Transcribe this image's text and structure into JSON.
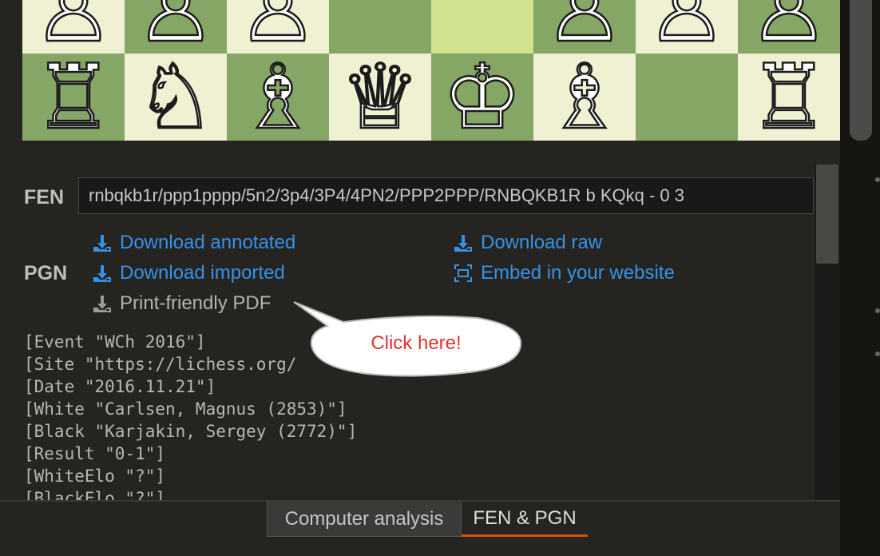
{
  "board": {
    "rows": [
      [
        {
          "piece": "♙",
          "name": "white-pawn-a2-icon",
          "shade": "light"
        },
        {
          "piece": "♙",
          "name": "white-pawn-b2-icon",
          "shade": "dark"
        },
        {
          "piece": "♙",
          "name": "white-pawn-c2-icon",
          "shade": "light"
        },
        {
          "piece": "",
          "name": "square-d2",
          "shade": "dark"
        },
        {
          "piece": "",
          "name": "square-e2",
          "shade": "hl-light"
        },
        {
          "piece": "♙",
          "name": "white-pawn-f2-icon",
          "shade": "dark"
        },
        {
          "piece": "♙",
          "name": "white-pawn-g2-icon",
          "shade": "light"
        },
        {
          "piece": "♙",
          "name": "white-pawn-h2-icon",
          "shade": "dark"
        }
      ],
      [
        {
          "piece": "♖",
          "name": "white-rook-a1-icon",
          "shade": "dark"
        },
        {
          "piece": "♘",
          "name": "white-knight-b1-icon",
          "shade": "light"
        },
        {
          "piece": "♗",
          "name": "white-bishop-c1-icon",
          "shade": "dark"
        },
        {
          "piece": "♕",
          "name": "white-queen-d1-icon",
          "shade": "light"
        },
        {
          "piece": "♔",
          "name": "white-king-e1-icon",
          "shade": "dark"
        },
        {
          "piece": "♗",
          "name": "white-bishop-f1-icon",
          "shade": "light"
        },
        {
          "piece": "",
          "name": "square-g1",
          "shade": "dark"
        },
        {
          "piece": "♖",
          "name": "white-rook-h1-icon",
          "shade": "light"
        }
      ]
    ]
  },
  "fen": {
    "label": "FEN",
    "value": "rnbqkb1r/ppp1pppp/5n2/3p4/3P4/4PN2/PPP2PPP/RNBQKB1R b KQkq - 0 3"
  },
  "pgn": {
    "label": "PGN",
    "links": {
      "download_annotated": "Download annotated",
      "download_raw": "Download raw",
      "download_imported": "Download imported",
      "embed": "Embed in your website",
      "print_pdf": "Print-friendly PDF"
    },
    "icons": {
      "download": "download-icon",
      "embed": "embed-icon"
    },
    "lines": [
      "[Event \"WCh 2016\"]",
      "[Site \"https://lichess.org/",
      "[Date \"2016.11.21\"]",
      "[White \"Carlsen, Magnus (2853)\"]",
      "[Black \"Karjakin, Sergey (2772)\"]",
      "[Result \"0-1\"]",
      "[WhiteElo \"?\"]",
      "[BlackElo \"?\"]"
    ]
  },
  "callout": {
    "text": "Click here!"
  },
  "tabs": {
    "computer_analysis": "Computer analysis",
    "fen_pgn": "FEN & PGN",
    "active": "FEN & PGN"
  },
  "colors": {
    "link": "#3692e7",
    "callout_text": "#e0342c",
    "active_tab_underline": "#d85000",
    "light_square": "#f0f0d2",
    "dark_square": "#86a666"
  }
}
